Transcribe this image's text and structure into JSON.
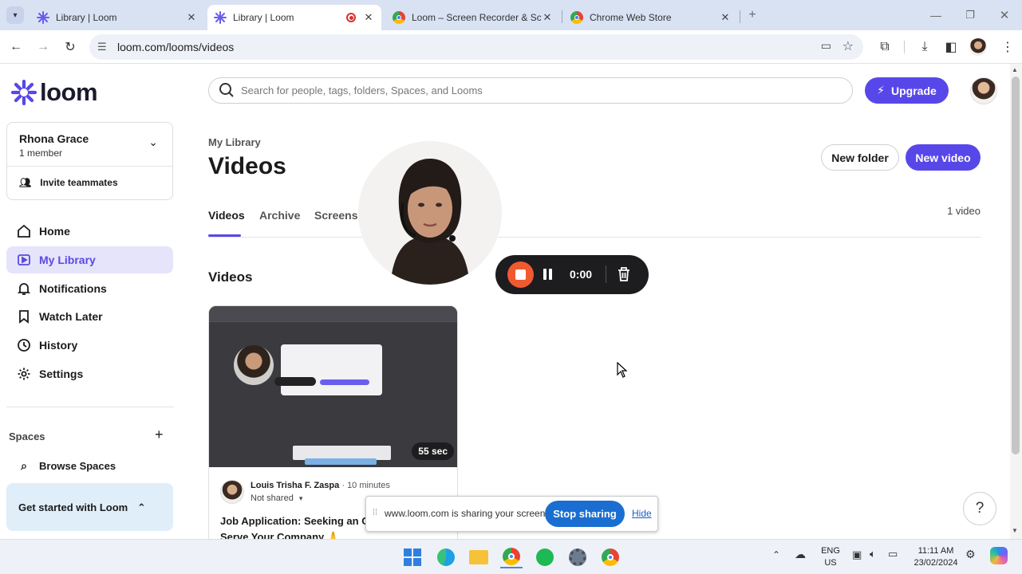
{
  "browser": {
    "tabs": [
      {
        "title": "Library | Loom",
        "active": false
      },
      {
        "title": "Library | Loom",
        "active": true,
        "recording": true
      },
      {
        "title": "Loom – Screen Recorder & Scre",
        "active": false
      },
      {
        "title": "Chrome Web Store",
        "active": false
      }
    ],
    "url": "loom.com/looms/videos"
  },
  "sidebar": {
    "logo_text": "loom",
    "workspace": {
      "name": "Rhona Grace",
      "members": "1 member",
      "invite": "Invite teammates"
    },
    "nav": [
      {
        "label": "Home",
        "icon": "home-icon"
      },
      {
        "label": "My Library",
        "icon": "library-icon",
        "active": true
      },
      {
        "label": "Notifications",
        "icon": "bell-icon"
      },
      {
        "label": "Watch Later",
        "icon": "bookmark-icon"
      },
      {
        "label": "History",
        "icon": "clock-icon"
      },
      {
        "label": "Settings",
        "icon": "gear-icon"
      }
    ],
    "spaces_label": "Spaces",
    "browse_spaces": "Browse Spaces",
    "get_started": "Get started with Loom"
  },
  "main": {
    "search_placeholder": "Search for people, tags, folders, Spaces, and Looms",
    "upgrade_label": "Upgrade",
    "breadcrumb": "My Library",
    "title": "Videos",
    "new_folder": "New folder",
    "new_video": "New video",
    "tabs": [
      "Videos",
      "Archive",
      "Screensh"
    ],
    "video_count": "1 video",
    "section_title": "Videos",
    "video": {
      "duration": "55 sec",
      "owner": "Louis Trisha F. Zaspa",
      "age": "10 minutes",
      "sharing": "Not shared",
      "title_line1": "Job Application: Seeking an O",
      "title_line2": "Serve Your Company 🙏"
    }
  },
  "recorder": {
    "timer": "0:00"
  },
  "share_bar": {
    "message": "www.loom.com is sharing your screen.",
    "stop_label": "Stop sharing",
    "hide_label": "Hide"
  },
  "help_label": "?",
  "taskbar": {
    "lang_line1": "ENG",
    "lang_line2": "US",
    "time": "11:11 AM",
    "date": "23/02/2024"
  },
  "colors": {
    "accent": "#5847e8",
    "share_blue": "#1a6ed1",
    "record_red": "#f05a30"
  }
}
